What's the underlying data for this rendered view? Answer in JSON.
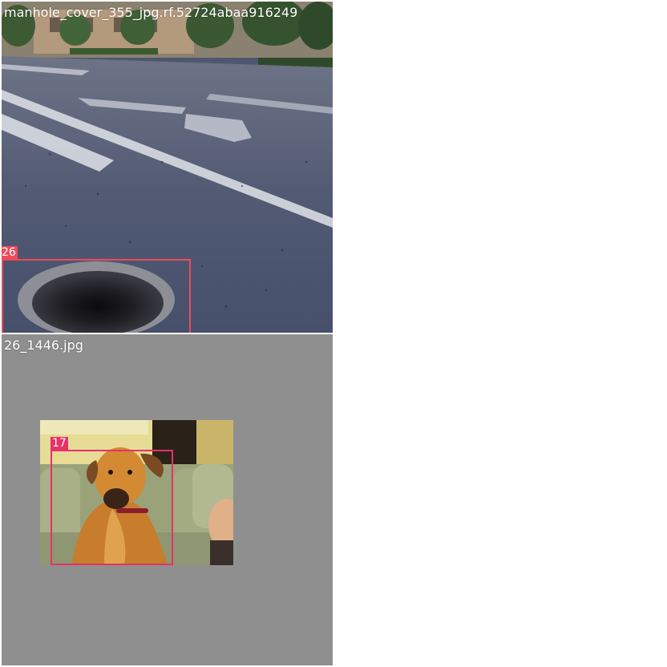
{
  "tiles": [
    {
      "caption": "manhole_cover_355_jpg.rf.52724abaa916249",
      "box_label": "26",
      "box_color": "#ef4a5c"
    },
    {
      "caption": "26_1446.jpg",
      "box_label": "17",
      "box_color": "#e8306a"
    }
  ],
  "colors": {
    "page_background": "#ffffff",
    "letterbox_gray": "#8f8f8f",
    "road_asphalt": "#4f5670"
  }
}
